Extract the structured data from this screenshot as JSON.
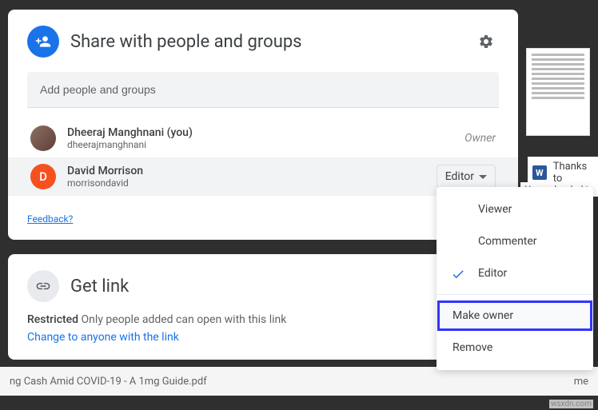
{
  "share": {
    "title": "Share with people and groups",
    "input_placeholder": "Add people and groups",
    "feedback_label": "Feedback?",
    "people": [
      {
        "name": "Dheeraj Manghnani (you)",
        "email": "dheerajmanghnani",
        "role": "Owner",
        "initial": "",
        "avatar_type": "image"
      },
      {
        "name": "David Morrison",
        "email": "morrisondavid",
        "role": "Editor",
        "initial": "D",
        "avatar_type": "letter"
      }
    ]
  },
  "getlink": {
    "title": "Get link",
    "restricted_label": "Restricted",
    "restricted_desc": "Only people added can open with this link",
    "change_label": "Change to anyone with the link"
  },
  "role_menu": {
    "items": [
      {
        "label": "Viewer",
        "checked": false
      },
      {
        "label": "Commenter",
        "checked": false
      },
      {
        "label": "Editor",
        "checked": true
      }
    ],
    "actions": [
      {
        "label": "Make owner",
        "highlighted": true
      },
      {
        "label": "Remove",
        "highlighted": false
      }
    ]
  },
  "background": {
    "file_name": "ng Cash Amid COVID-19 - A 1mg Guide.pdf",
    "file_owner": "me",
    "sidebar_label": "Thanks to",
    "sidebar_sub": "You uploaded in",
    "watermark": "wsxdn.com"
  }
}
